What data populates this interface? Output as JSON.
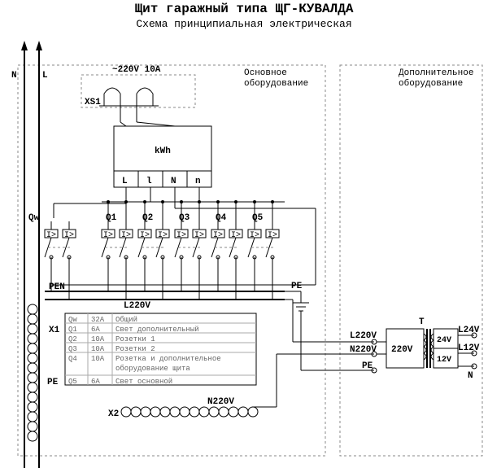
{
  "title": "Щит гаражный типа ЩГ-КУВАЛДА",
  "subtitle": "Схема принципиальная электрическая",
  "panels": {
    "main_label": "Основное\nоборудование",
    "aux_label": "Дополнительное\nоборудование"
  },
  "mains": {
    "n": "N",
    "l": "L"
  },
  "socket": {
    "ref": "XS1",
    "rating": "~220V 10A"
  },
  "meter": {
    "kwh": "kWh",
    "L": "L",
    "l": "l",
    "N": "N",
    "n": "n"
  },
  "breakers": {
    "qw": "Qw",
    "q1": "Q1",
    "q2": "Q2",
    "q3": "Q3",
    "q4": "Q4",
    "q5": "Q5",
    "ir": "I>"
  },
  "buses": {
    "pen": "PEN",
    "l220v": "L220V",
    "pe": "PE",
    "n220v": "N220V"
  },
  "terminals": {
    "x1": "X1",
    "pe": "PE",
    "x2": "X2"
  },
  "transformer": {
    "ref": "T",
    "prim_l": "L220V",
    "prim_n": "N220V",
    "prim_pe": "PE",
    "prim_v": "220V",
    "sec24": "24V",
    "sec12": "12V",
    "out_l24": "L24V",
    "out_l12": "L12V",
    "out_n": "N"
  },
  "table": {
    "rows": [
      {
        "ref": "Qw",
        "amps": "32A",
        "desc": "Общий"
      },
      {
        "ref": "Q1",
        "amps": "6A",
        "desc": "Свет дополнительный"
      },
      {
        "ref": "Q2",
        "amps": "10A",
        "desc": "Розетки 1"
      },
      {
        "ref": "Q3",
        "amps": "10A",
        "desc": "Розетки 2"
      },
      {
        "ref": "Q4",
        "amps": "10A",
        "desc": "Розетка и дополнительное оборудование щита"
      },
      {
        "ref": "Q5",
        "amps": "6A",
        "desc": "Свет основной"
      }
    ]
  }
}
